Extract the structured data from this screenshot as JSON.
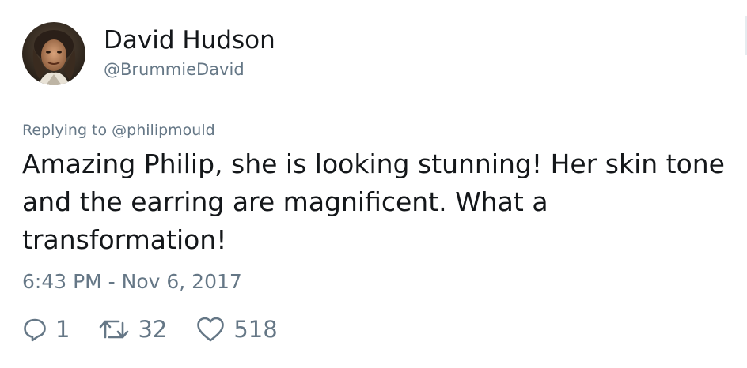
{
  "author": {
    "display_name": "David Hudson",
    "handle": "@BrummieDavid"
  },
  "reply_context": {
    "prefix": "Replying to ",
    "mention": "@philipmould"
  },
  "tweet": {
    "text": "Amazing Philip, she is looking stunning! Her skin tone and the earring are magnificent. What a transformation!",
    "timestamp": "6:43 PM - Nov 6, 2017"
  },
  "actions": {
    "reply": {
      "icon": "reply-icon",
      "count": "1"
    },
    "retweet": {
      "icon": "retweet-icon",
      "count": "32"
    },
    "like": {
      "icon": "heart-icon",
      "count": "518"
    }
  },
  "colors": {
    "text_primary": "#14171a",
    "text_secondary": "#657786",
    "background": "#ffffff"
  }
}
